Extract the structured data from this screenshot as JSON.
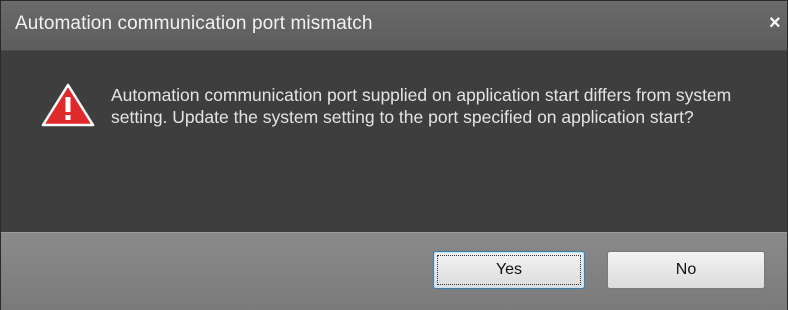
{
  "dialog": {
    "title": "Automation communication port mismatch",
    "close_glyph": "×",
    "icon": "warning-triangle-icon",
    "message": "Automation communication port supplied on application start differs from system setting. Update the system setting to the port specified on application start?",
    "buttons": {
      "yes_label": "Yes",
      "no_label": "No"
    }
  },
  "colors": {
    "titlebar": "#626262",
    "body": "#3e3e3e",
    "footer": "#848484",
    "warning_red": "#e0292b",
    "focus_blue": "#3c7fb1"
  }
}
